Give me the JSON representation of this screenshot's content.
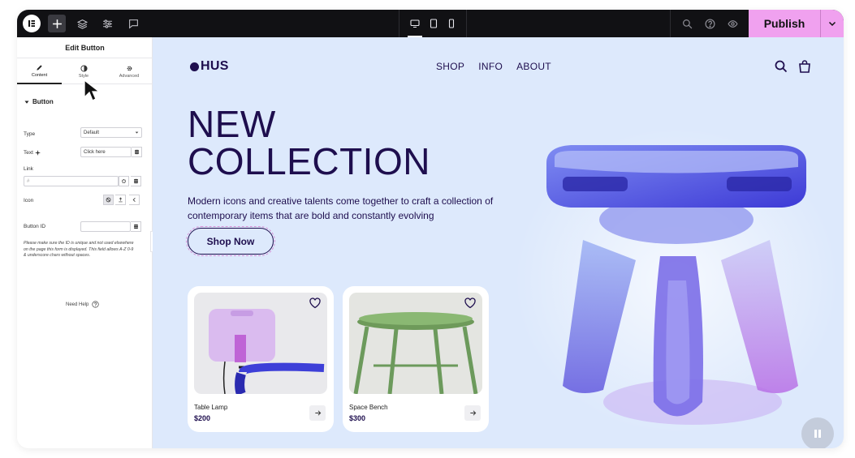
{
  "topbar": {
    "logo_icon": "elementor-logo-icon",
    "tools": [
      "add-icon",
      "layers-icon",
      "settings-sliders-icon",
      "comments-icon"
    ],
    "devices": [
      "desktop-icon",
      "tablet-icon",
      "mobile-icon"
    ],
    "right_tools": [
      "search-icon",
      "help-icon",
      "preview-eye-icon"
    ],
    "publish_label": "Publish"
  },
  "panel": {
    "title": "Edit Button",
    "tabs": [
      {
        "label": "Content",
        "icon": "pencil-icon"
      },
      {
        "label": "Style",
        "icon": "contrast-icon"
      },
      {
        "label": "Advanced",
        "icon": "gear-icon"
      }
    ],
    "section_title": "Button",
    "fields": {
      "type_label": "Type",
      "type_value": "Default",
      "text_label": "Text",
      "text_value": "Click here",
      "link_label": "Link",
      "link_placeholder": "#",
      "icon_label": "Icon",
      "button_id_label": "Button ID"
    },
    "note": "Please make sure the ID is unique and not used elsewhere on the page this form is displayed. This field allows A-Z 0-9 & underscore chars without spaces.",
    "need_help": "Need Help"
  },
  "site": {
    "brand": "HUS",
    "nav": [
      "SHOP",
      "INFO",
      "ABOUT"
    ],
    "hero_line1": "NEW",
    "hero_line2": "COLLECTION",
    "hero_desc": "Modern icons and creative talents come together to craft a collection of contemporary items that are bold and constantly evolving",
    "cta": "Shop Now",
    "products": [
      {
        "name": "Table Lamp",
        "price": "$200"
      },
      {
        "name": "Space Bench",
        "price": "$300"
      }
    ]
  },
  "colors": {
    "accent_publish": "#f0a1ef",
    "canvas_bg": "#dde9fc",
    "brand_text": "#1e0e4e"
  }
}
